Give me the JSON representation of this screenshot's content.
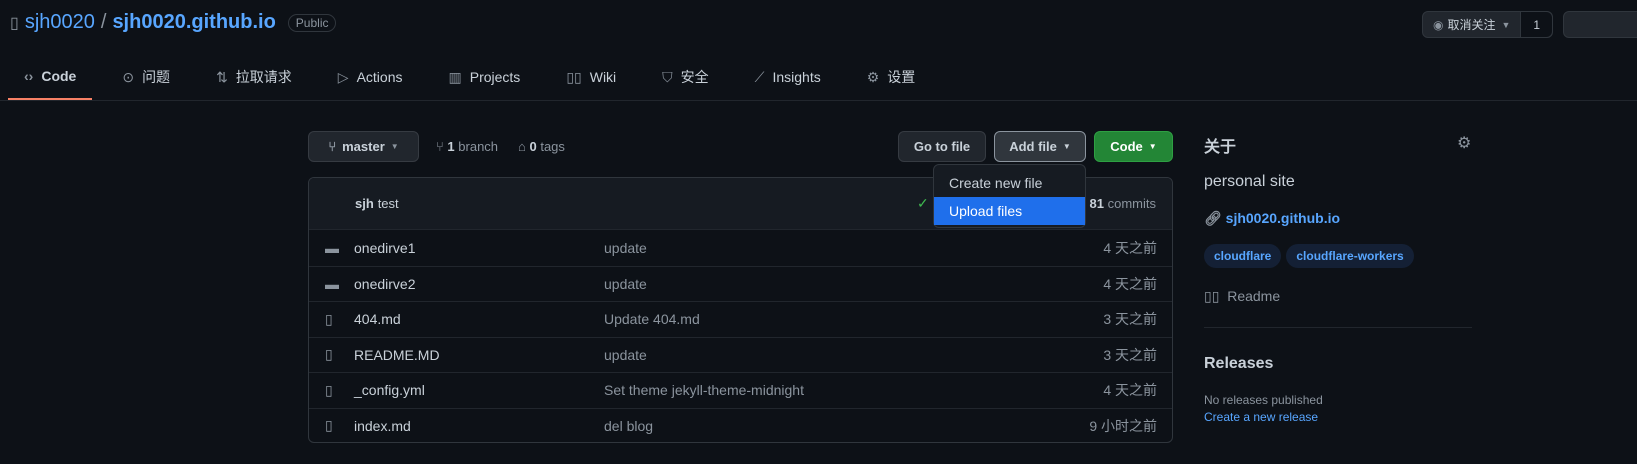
{
  "repo": {
    "owner": "sjh0020",
    "separator": "/",
    "name": "sjh0020.github.io",
    "visibility": "Public"
  },
  "watch": {
    "label": "取消关注",
    "count": "1"
  },
  "tabs": [
    {
      "label": "Code",
      "icon": "code-icon"
    },
    {
      "label": "问题",
      "icon": "issue-icon"
    },
    {
      "label": "拉取请求",
      "icon": "pull-request-icon"
    },
    {
      "label": "Actions",
      "icon": "play-icon"
    },
    {
      "label": "Projects",
      "icon": "project-icon"
    },
    {
      "label": "Wiki",
      "icon": "book-icon"
    },
    {
      "label": "安全",
      "icon": "shield-icon"
    },
    {
      "label": "Insights",
      "icon": "graph-icon"
    },
    {
      "label": "设置",
      "icon": "gear-icon"
    }
  ],
  "toolbar": {
    "branch": "master",
    "branch_count": "1",
    "branch_label": "branch",
    "tag_count": "0",
    "tag_label": "tags",
    "go_to_file": "Go to file",
    "add_file": "Add file",
    "code": "Code"
  },
  "add_file_menu": [
    "Create new file",
    "Upload files"
  ],
  "commit": {
    "author": "sjh",
    "message": "test",
    "count": "81",
    "count_label": "commits"
  },
  "files": [
    {
      "type": "folder",
      "name": "onedirve1",
      "message": "update",
      "time": "4 天之前"
    },
    {
      "type": "folder",
      "name": "onedirve2",
      "message": "update",
      "time": "4 天之前"
    },
    {
      "type": "file",
      "name": "404.md",
      "message": "Update 404.md",
      "time": "3 天之前"
    },
    {
      "type": "file",
      "name": "README.MD",
      "message": "update",
      "time": "3 天之前"
    },
    {
      "type": "file",
      "name": "_config.yml",
      "message": "Set theme jekyll-theme-midnight",
      "time": "4 天之前"
    },
    {
      "type": "file",
      "name": "index.md",
      "message": "del blog",
      "time": "9 小时之前"
    }
  ],
  "about": {
    "heading": "关于",
    "description": "personal site",
    "website": "sjh0020.github.io",
    "topics": [
      "cloudflare",
      "cloudflare-workers"
    ],
    "readme": "Readme"
  },
  "releases": {
    "heading": "Releases",
    "empty": "No releases published",
    "create": "Create a new release"
  }
}
